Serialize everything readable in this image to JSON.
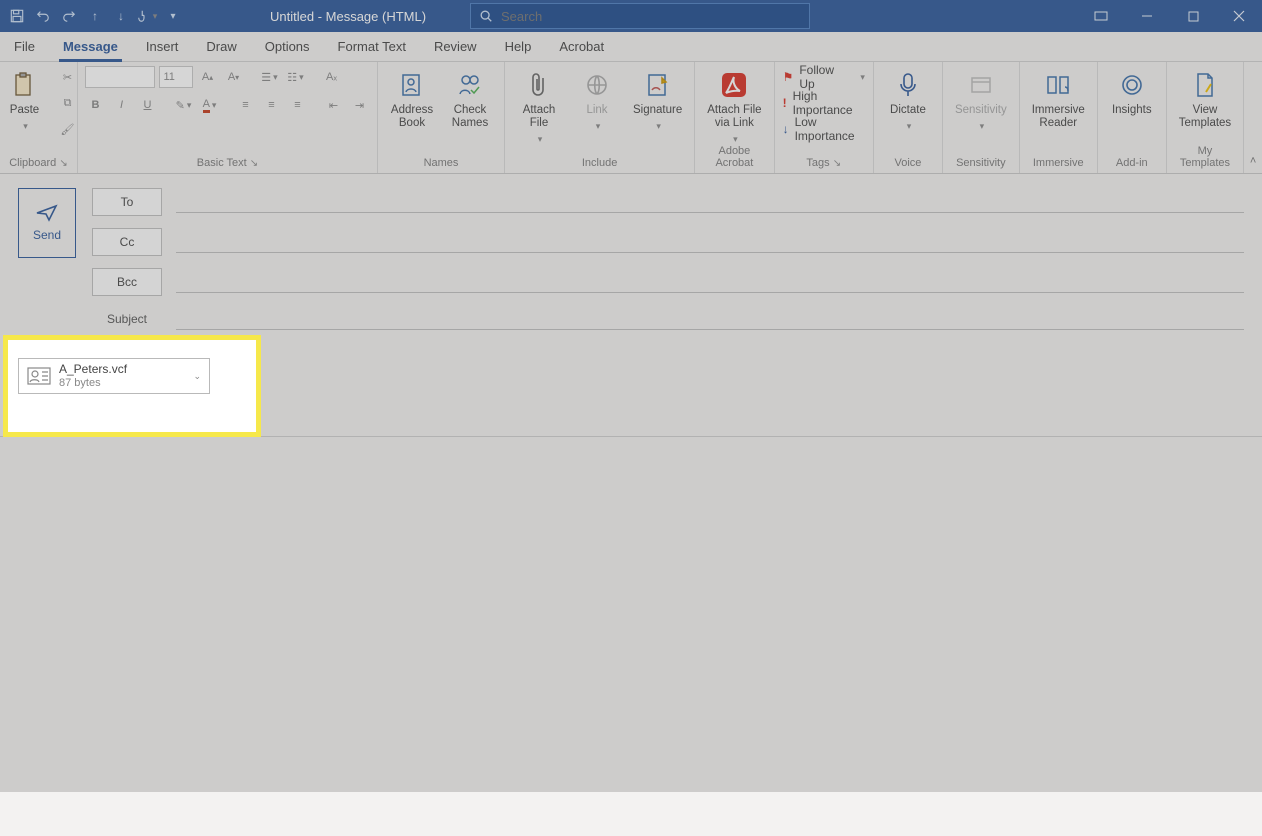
{
  "window": {
    "title": "Untitled  -  Message (HTML)",
    "search_placeholder": "Search"
  },
  "tabs": {
    "file": "File",
    "message": "Message",
    "insert": "Insert",
    "draw": "Draw",
    "options": "Options",
    "format": "Format Text",
    "review": "Review",
    "help": "Help",
    "acrobat": "Acrobat"
  },
  "ribbon": {
    "clipboard": {
      "paste": "Paste",
      "label": "Clipboard"
    },
    "basic_text": {
      "label": "Basic Text",
      "font_size": "11"
    },
    "names": {
      "address_book": "Address\nBook",
      "check_names": "Check\nNames",
      "label": "Names"
    },
    "include": {
      "attach_file": "Attach\nFile",
      "link": "Link",
      "signature": "Signature",
      "label": "Include"
    },
    "adobe": {
      "attach_link": "Attach File\nvia Link",
      "label": "Adobe Acrobat"
    },
    "tags": {
      "follow_up": "Follow Up",
      "high": "High Importance",
      "low": "Low Importance",
      "label": "Tags"
    },
    "voice": {
      "dictate": "Dictate",
      "label": "Voice"
    },
    "sensitivity": {
      "btn": "Sensitivity",
      "label": "Sensitivity"
    },
    "immersive": {
      "btn": "Immersive\nReader",
      "label": "Immersive"
    },
    "addin": {
      "btn": "Insights",
      "label": "Add-in"
    },
    "templates": {
      "btn": "View\nTemplates",
      "label": "My Templates"
    }
  },
  "compose": {
    "send": "Send",
    "to": "To",
    "cc": "Cc",
    "bcc": "Bcc",
    "subject": "Subject"
  },
  "attachment": {
    "name": "A_Peters.vcf",
    "size": "87 bytes"
  }
}
